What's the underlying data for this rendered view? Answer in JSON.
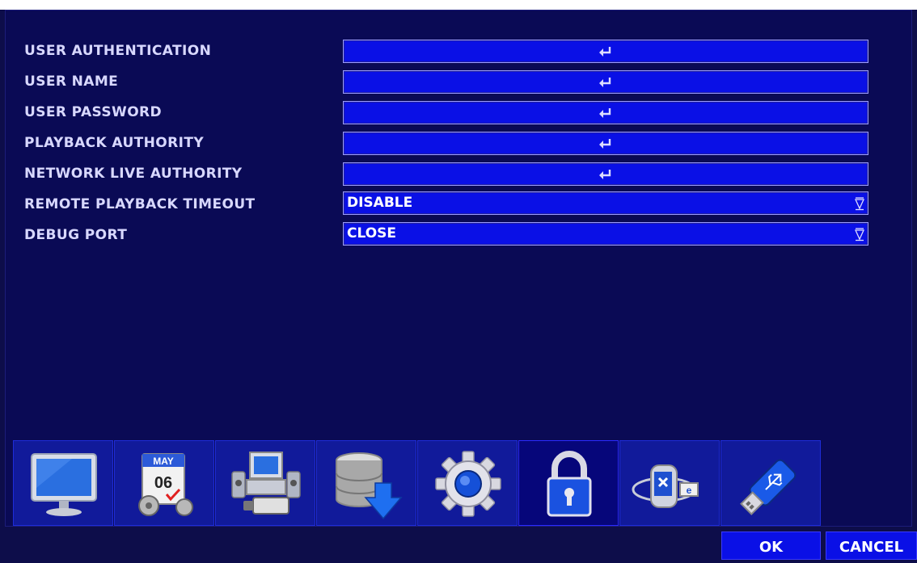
{
  "settings": {
    "rows": [
      {
        "label": "USER AUTHENTICATION"
      },
      {
        "label": "USER NAME"
      },
      {
        "label": "USER PASSWORD"
      },
      {
        "label": "PLAYBACK AUTHORITY"
      },
      {
        "label": "NETWORK LIVE AUTHORITY"
      },
      {
        "label": "REMOTE PLAYBACK TIMEOUT",
        "value": "DISABLE"
      },
      {
        "label": "DEBUG PORT",
        "value": "CLOSE"
      }
    ]
  },
  "tabs": {
    "calendar_month": "MAY",
    "calendar_day": "06",
    "items": [
      {
        "icon": "display-icon"
      },
      {
        "icon": "calendar-icon"
      },
      {
        "icon": "devices-icon"
      },
      {
        "icon": "storage-icon"
      },
      {
        "icon": "gear-icon"
      },
      {
        "icon": "lock-icon",
        "active": true
      },
      {
        "icon": "network-icon"
      },
      {
        "icon": "usb-icon"
      }
    ]
  },
  "buttons": {
    "ok_label": "OK",
    "cancel_label": "CANCEL"
  },
  "colors": {
    "background": "#0a0a55",
    "field": "#0a10e6",
    "label_text": "#d8d8ff"
  }
}
